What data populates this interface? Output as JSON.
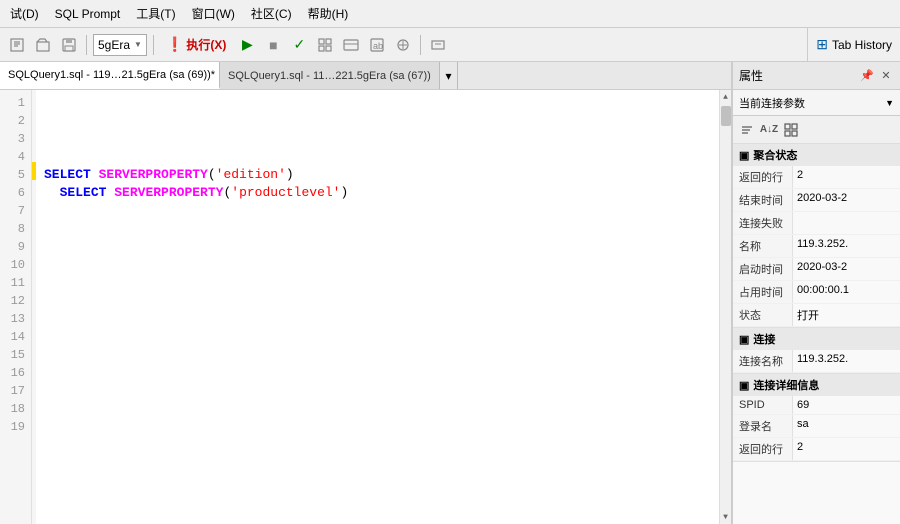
{
  "menubar": {
    "items": [
      {
        "label": "试(D)",
        "id": "menu-test"
      },
      {
        "label": "SQL Prompt",
        "id": "menu-sql-prompt"
      },
      {
        "label": "工具(T)",
        "id": "menu-tools"
      },
      {
        "label": "窗口(W)",
        "id": "menu-window"
      },
      {
        "label": "社区(C)",
        "id": "menu-community"
      },
      {
        "label": "帮助(H)",
        "id": "menu-help"
      }
    ]
  },
  "toolbar": {
    "connection_dropdown": "5gEra",
    "execute_label": "执行(X)",
    "tab_history_label": "Tab History"
  },
  "tabs": [
    {
      "id": "tab1",
      "label": "SQLQuery1.sql - 119…21.5gEra (sa (69))*",
      "active": true,
      "closable": true
    },
    {
      "id": "tab2",
      "label": "SQLQuery1.sql - 11…221.5gEra (sa (67))",
      "active": false,
      "closable": true
    }
  ],
  "editor": {
    "line_count": 19,
    "lines": [
      {
        "num": 1,
        "content": "",
        "has_marker": false
      },
      {
        "num": 2,
        "content": "",
        "has_marker": false
      },
      {
        "num": 3,
        "content": "",
        "has_marker": false
      },
      {
        "num": 4,
        "content": "",
        "has_marker": false
      },
      {
        "num": 5,
        "content": "SELECT SERVERPROPERTY('edition')",
        "has_marker": true
      },
      {
        "num": 6,
        "content": "  SELECT SERVERPROPERTY('productlevel')",
        "has_marker": false
      },
      {
        "num": 7,
        "content": "",
        "has_marker": false
      },
      {
        "num": 8,
        "content": "",
        "has_marker": false
      },
      {
        "num": 9,
        "content": "",
        "has_marker": false
      },
      {
        "num": 10,
        "content": "",
        "has_marker": false
      },
      {
        "num": 11,
        "content": "",
        "has_marker": false
      },
      {
        "num": 12,
        "content": "",
        "has_marker": false
      },
      {
        "num": 13,
        "content": "",
        "has_marker": false
      },
      {
        "num": 14,
        "content": "",
        "has_marker": false
      },
      {
        "num": 15,
        "content": "",
        "has_marker": false
      },
      {
        "num": 16,
        "content": "",
        "has_marker": false
      },
      {
        "num": 17,
        "content": "",
        "has_marker": false
      },
      {
        "num": 18,
        "content": "",
        "has_marker": false
      },
      {
        "num": 19,
        "content": "",
        "has_marker": false
      }
    ]
  },
  "properties_panel": {
    "title": "属性",
    "dropdown_label": "当前连接参数",
    "sections": [
      {
        "title": "聚合状态",
        "expanded": true,
        "rows": [
          {
            "name": "返回的行",
            "value": "2"
          },
          {
            "name": "结束时间",
            "value": "2020-03-2"
          },
          {
            "name": "连接失败",
            "value": ""
          },
          {
            "name": "名称",
            "value": "119.3.252."
          },
          {
            "name": "启动时间",
            "value": "2020-03-2"
          },
          {
            "name": "占用时间",
            "value": "00:00:00.1"
          },
          {
            "name": "状态",
            "value": "打开"
          }
        ]
      },
      {
        "title": "连接",
        "expanded": true,
        "rows": [
          {
            "name": "连接名称",
            "value": "119.3.252."
          }
        ]
      },
      {
        "title": "连接详细信息",
        "expanded": true,
        "rows": [
          {
            "name": "SPID",
            "value": "69"
          },
          {
            "name": "登录名",
            "value": "sa"
          },
          {
            "name": "返回的行",
            "value": "2"
          }
        ]
      }
    ]
  }
}
